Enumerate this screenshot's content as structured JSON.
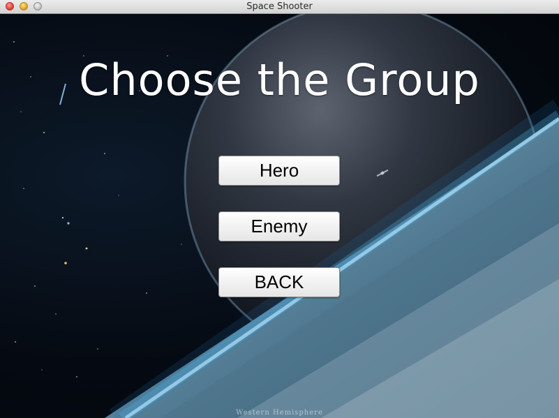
{
  "window": {
    "title": "Space Shooter"
  },
  "screen": {
    "heading": "Choose the Group",
    "buttons": {
      "hero": "Hero",
      "enemy": "Enemy",
      "back": "BACK"
    },
    "watermark": "Western Hemisphere"
  },
  "colors": {
    "heading_text": "#ffffff",
    "button_bg": "#f2f2f2",
    "button_text": "#000000"
  }
}
